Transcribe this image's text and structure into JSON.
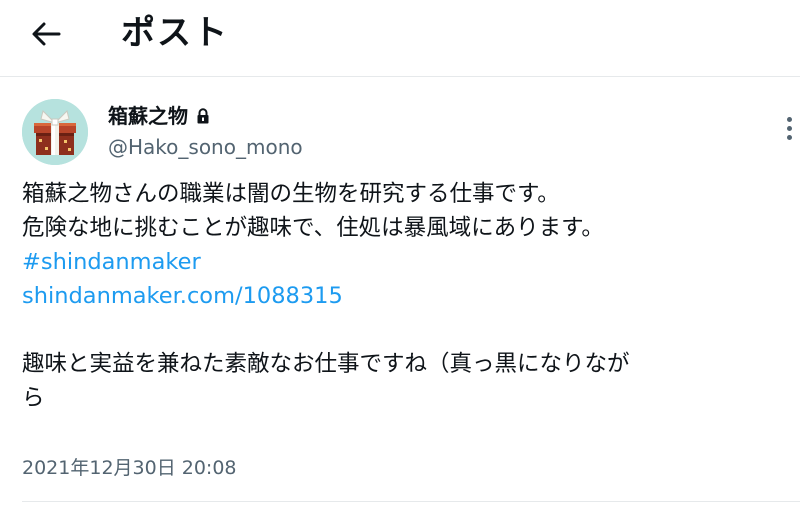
{
  "header": {
    "title": "ポスト",
    "back_icon": "arrow-left-icon"
  },
  "tweet": {
    "author": {
      "display_name": "箱蘇之物",
      "handle": "@Hako_sono_mono",
      "lock_icon": "lock-icon",
      "avatar_icon": "gift-box-avatar"
    },
    "body": {
      "line1": "箱蘇之物さんの職業は闇の生物を研究する仕事です。",
      "line2": "危険な地に挑むことが趣味で、住処は暴風域にあります。",
      "hashtag": "#shindanmaker",
      "url": "shindanmaker.com/1088315",
      "line5": "趣味と実益を兼ねた素敵なお仕事ですね（真っ黒になりなが",
      "line6": "ら"
    },
    "timestamp": "2021年12月30日 20:08"
  },
  "colors": {
    "link": "#1d9bf0",
    "secondary_text": "#536471",
    "primary_text": "#0f1419",
    "divider": "#e6e9eb"
  }
}
